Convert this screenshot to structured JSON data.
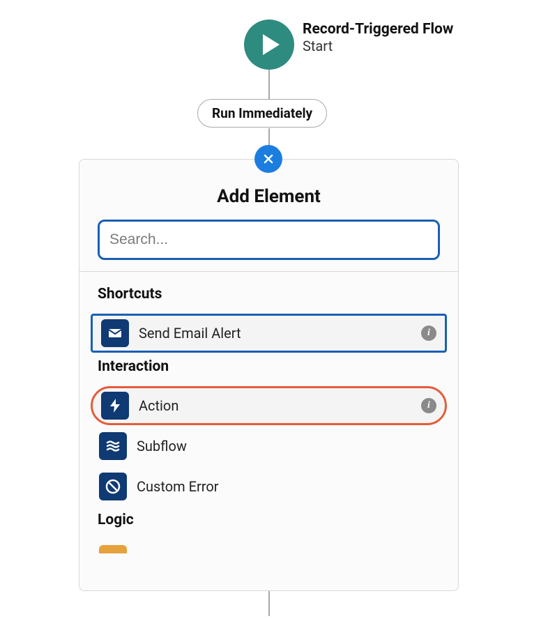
{
  "flow": {
    "title": "Record-Triggered Flow",
    "subtitle": "Start",
    "run_label": "Run Immediately"
  },
  "panel": {
    "title": "Add Element",
    "search_placeholder": "Search...",
    "sections": {
      "shortcuts": {
        "label": "Shortcuts",
        "items": {
          "send_email": "Send Email Alert"
        }
      },
      "interaction": {
        "label": "Interaction",
        "items": {
          "action": "Action",
          "subflow": "Subflow",
          "custom_error": "Custom Error"
        }
      },
      "logic": {
        "label": "Logic"
      }
    }
  },
  "icons": {
    "info": "i"
  }
}
